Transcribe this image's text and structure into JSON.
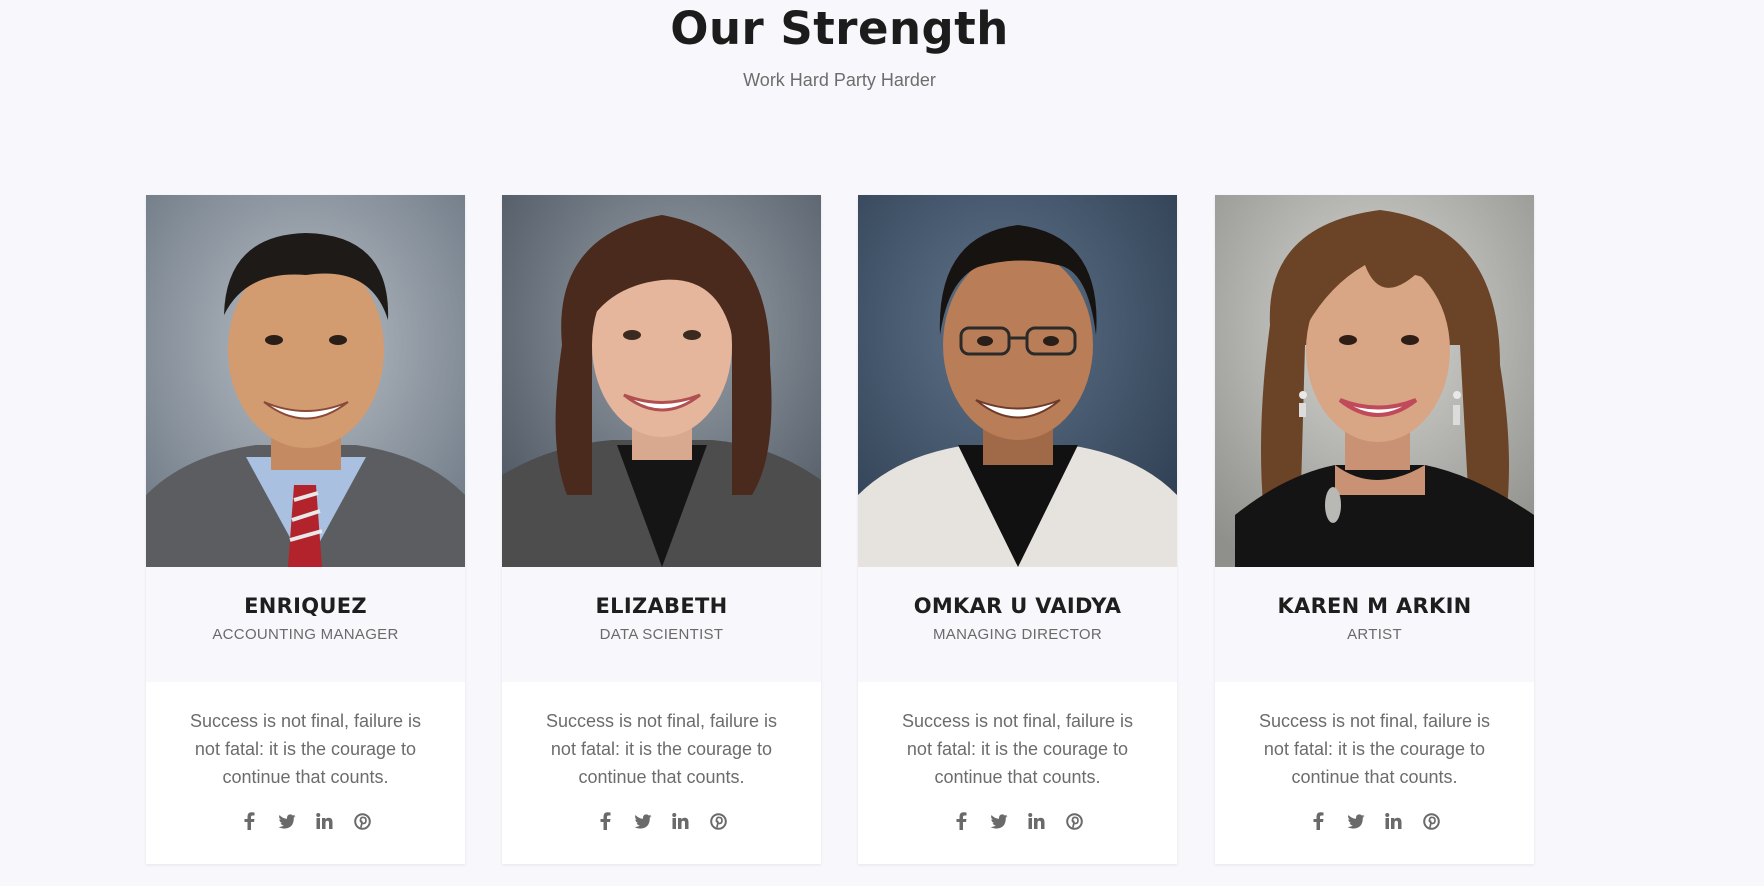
{
  "section": {
    "title": "Our Strength",
    "subtitle": "Work Hard Party Harder"
  },
  "members": [
    {
      "name": "ENRIQUEZ",
      "role": "ACCOUNTING MANAGER",
      "quote": "Success is not final, failure is not fatal: it is the courage to continue that counts.",
      "photo_icon": "portrait-photo-man-red-tie"
    },
    {
      "name": "ELIZABETH",
      "role": "DATA SCIENTIST",
      "quote": "Success is not final, failure is not fatal: it is the courage to continue that counts.",
      "photo_icon": "portrait-photo-woman-brown-hair"
    },
    {
      "name": "OMKAR U VAIDYA",
      "role": "MANAGING DIRECTOR",
      "quote": "Success is not final, failure is not fatal: it is the courage to continue that counts.",
      "photo_icon": "portrait-photo-man-glasses"
    },
    {
      "name": "KAREN M ARKIN",
      "role": "ARTIST",
      "quote": "Success is not final, failure is not fatal: it is the courage to continue that counts.",
      "photo_icon": "portrait-photo-woman-earrings"
    }
  ],
  "social_icons": [
    "facebook-icon",
    "twitter-icon",
    "linkedin-icon",
    "pinterest-icon"
  ],
  "colors": {
    "background": "#f8f8fc",
    "card": "#ffffff",
    "heading": "#1c1c1c",
    "muted_text": "#6c6c6c",
    "icon": "#6a6a6a"
  }
}
